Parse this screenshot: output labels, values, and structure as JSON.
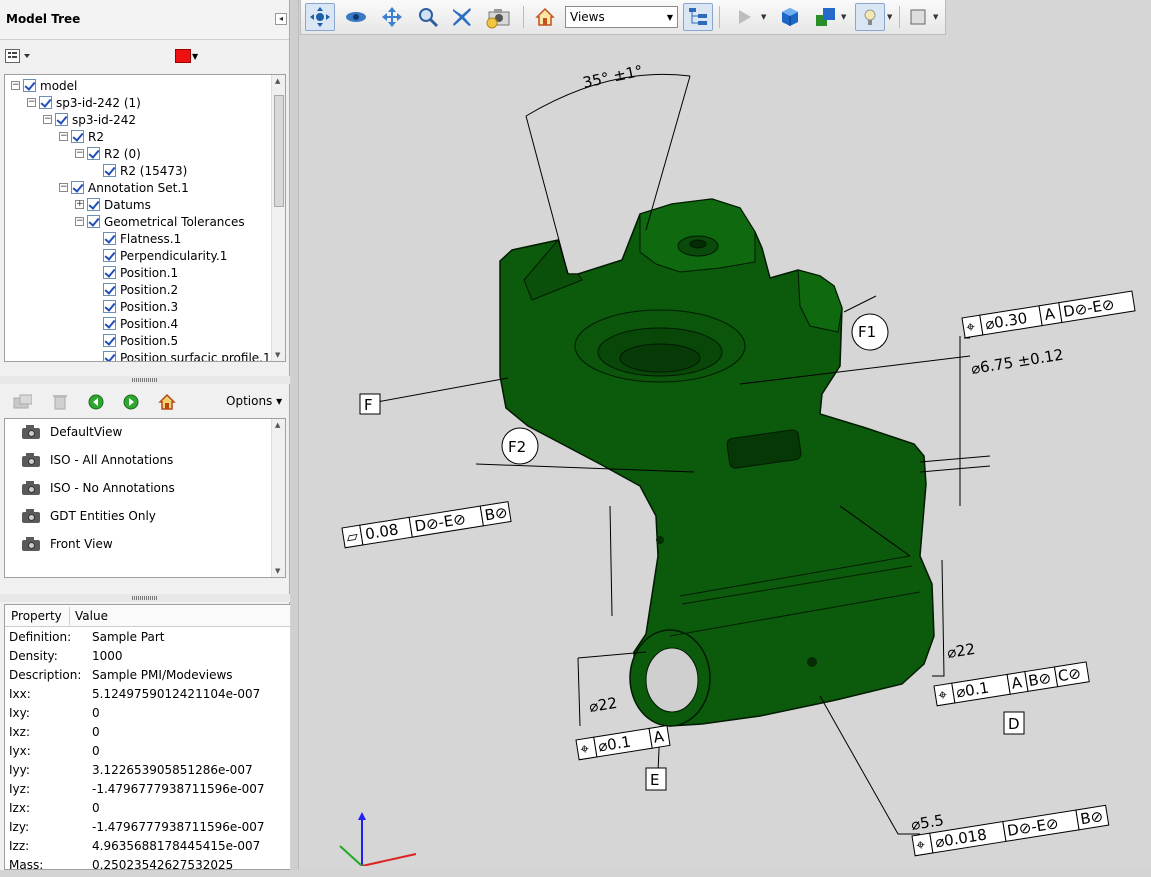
{
  "panel": {
    "title": "Model Tree",
    "collapse_glyph": "◂",
    "color_accent": "#ee1111"
  },
  "tree": {
    "items": [
      {
        "label": "model",
        "level": 0,
        "expander": "minus"
      },
      {
        "label": "sp3-id-242 (1)",
        "level": 1,
        "expander": "minus"
      },
      {
        "label": "sp3-id-242",
        "level": 2,
        "expander": "minus"
      },
      {
        "label": "R2",
        "level": 3,
        "expander": "minus"
      },
      {
        "label": "R2 (0)",
        "level": 4,
        "expander": "minus"
      },
      {
        "label": "R2 (15473)",
        "level": 5,
        "expander": "none"
      },
      {
        "label": "Annotation Set.1",
        "level": 3,
        "expander": "minus"
      },
      {
        "label": "Datums",
        "level": 4,
        "expander": "plus"
      },
      {
        "label": "Geometrical Tolerances",
        "level": 4,
        "expander": "minus"
      },
      {
        "label": "Flatness.1",
        "level": 5,
        "expander": "none"
      },
      {
        "label": "Perpendicularity.1",
        "level": 5,
        "expander": "none"
      },
      {
        "label": "Position.1",
        "level": 5,
        "expander": "none"
      },
      {
        "label": "Position.2",
        "level": 5,
        "expander": "none"
      },
      {
        "label": "Position.3",
        "level": 5,
        "expander": "none"
      },
      {
        "label": "Position.4",
        "level": 5,
        "expander": "none"
      },
      {
        "label": "Position.5",
        "level": 5,
        "expander": "none"
      },
      {
        "label": "Position surfacic profile.1",
        "level": 5,
        "expander": "none"
      }
    ]
  },
  "views_toolbar": {
    "options_label": "Options",
    "icons": [
      "camera-add-icon",
      "trash-icon",
      "back-arrow-icon",
      "forward-arrow-icon",
      "home-icon"
    ]
  },
  "views": {
    "items": [
      "DefaultView",
      "ISO - All Annotations",
      "ISO - No Annotations",
      "GDT Entities Only",
      "Front View"
    ]
  },
  "properties": {
    "header_property": "Property",
    "header_value": "Value",
    "rows": [
      {
        "key": "Definition:",
        "value": "Sample Part"
      },
      {
        "key": "Density:",
        "value": "1000"
      },
      {
        "key": "Description:",
        "value": "Sample PMI/Modeviews"
      },
      {
        "key": "Ixx:",
        "value": "5.1249759012421104e-007"
      },
      {
        "key": "Ixy:",
        "value": "0"
      },
      {
        "key": "Ixz:",
        "value": "0"
      },
      {
        "key": "Iyx:",
        "value": "0"
      },
      {
        "key": "Iyy:",
        "value": "3.122653905851286e-007"
      },
      {
        "key": "Iyz:",
        "value": "-1.4796777938711596e-007"
      },
      {
        "key": "Izx:",
        "value": "0"
      },
      {
        "key": "Izy:",
        "value": "-1.4796777938711596e-007"
      },
      {
        "key": "Izz:",
        "value": "4.9635688178445415e-007"
      },
      {
        "key": "Mass:",
        "value": "0.25023542627532025"
      }
    ]
  },
  "toolbar": {
    "views_select": "Views",
    "icons": [
      "rotate-icon",
      "spin-icon",
      "pan-icon",
      "zoom-icon",
      "fly-icon",
      "camera-properties-icon",
      "home-view-icon",
      "model-tree-toggle-icon",
      "play-icon",
      "cube-icon",
      "shaded-cubes-icon",
      "lighting-icon",
      "background-color-icon"
    ]
  },
  "model": {
    "part_color": "#0c5a0c",
    "annotations": {
      "angle": "35° ±1°",
      "flatness": [
        "⏥",
        "0.08",
        "D⊘-E⊘",
        "B⊘"
      ],
      "position_top": [
        "⌖",
        "⌀0.30",
        "A",
        "D⊘-E⊘"
      ],
      "diameter_675": "⌀6.75 ±0.12",
      "diameter_22_right": "⌀22",
      "position_right": [
        "⌖",
        "⌀0.1",
        "A",
        "B⊘",
        "C⊘"
      ],
      "diameter_22_left": "⌀22",
      "position_left": [
        "⌖",
        "⌀0.1",
        "A"
      ],
      "diameter_55": "⌀5.5",
      "position_bottom": [
        "⌖",
        "⌀0.018",
        "D⊘-E⊘",
        "B⊘"
      ],
      "datum_f": "F",
      "datum_f1": "F1",
      "datum_f2": "F2",
      "datum_d": "D",
      "datum_e": "E"
    }
  }
}
